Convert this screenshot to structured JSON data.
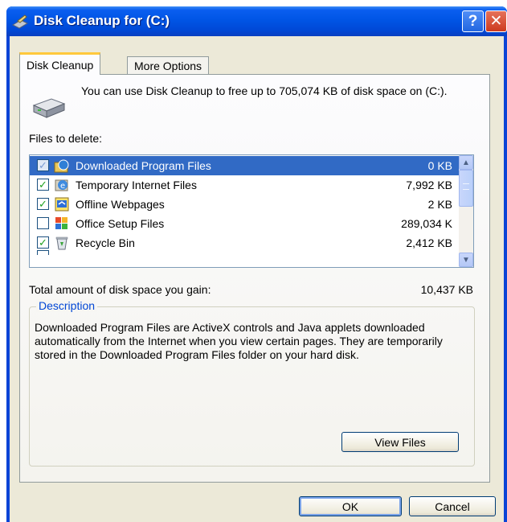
{
  "window": {
    "title": "Disk Cleanup for  (C:)",
    "help_label": "?",
    "close_label": "✕"
  },
  "tabs": [
    {
      "label": "Disk Cleanup",
      "active": true
    },
    {
      "label": "More Options",
      "active": false
    }
  ],
  "panel": {
    "intro": "You can use Disk Cleanup to free up to 705,074 KB of disk space on  (C:).",
    "files_label": "Files to delete:",
    "files": [
      {
        "name": "Downloaded Program Files",
        "size": "0 KB",
        "checked": true,
        "selected": true,
        "icon": "globe-folder-icon"
      },
      {
        "name": "Temporary Internet Files",
        "size": "7,992 KB",
        "checked": true,
        "selected": false,
        "icon": "ie-icon"
      },
      {
        "name": "Offline Webpages",
        "size": "2 KB",
        "checked": true,
        "selected": false,
        "icon": "offline-pages-icon"
      },
      {
        "name": "Office Setup Files",
        "size": "289,034 K",
        "checked": false,
        "selected": false,
        "icon": "office-icon"
      },
      {
        "name": "Recycle Bin",
        "size": "2,412 KB",
        "checked": true,
        "selected": false,
        "icon": "recycle-bin-icon"
      }
    ],
    "total_label": "Total amount of disk space you gain:",
    "total_value": "10,437 KB",
    "description_title": "Description",
    "description": "Downloaded Program Files are ActiveX controls and Java applets downloaded automatically from the Internet when you view certain pages. They are temporarily stored in the Downloaded Program Files folder on your hard disk.",
    "view_files_label": "View Files"
  },
  "footer": {
    "ok_label": "OK",
    "cancel_label": "Cancel"
  },
  "colors": {
    "title_bar": "#0055e5",
    "selection": "#316ac5",
    "face": "#ece9d8",
    "group_title": "#0046d5"
  }
}
